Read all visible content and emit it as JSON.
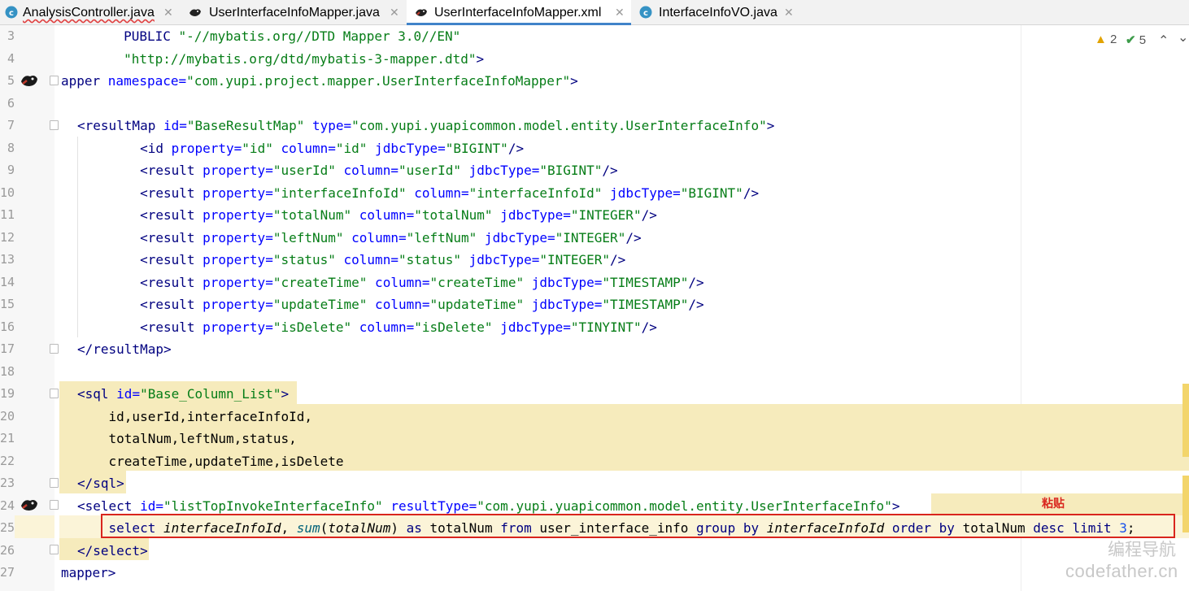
{
  "tabs": [
    {
      "label": "AnalysisController.java",
      "icon": "java-class-icon"
    },
    {
      "label": "UserInterfaceInfoMapper.java",
      "icon": "mybatis-icon"
    },
    {
      "label": "UserInterfaceInfoMapper.xml",
      "icon": "mybatis-icon",
      "active": true
    },
    {
      "label": "InterfaceInfoVO.java",
      "icon": "java-class-icon"
    }
  ],
  "tab_close": "✕",
  "status": {
    "warnings": "2",
    "checks": "5",
    "up": "⌃",
    "down": "⌄"
  },
  "lines": [
    {
      "n": "3",
      "t": [
        "        PUBLIC ",
        "\"-//mybatis.org//DTD Mapper 3.0//EN\""
      ]
    },
    {
      "n": "4",
      "t": [
        "        ",
        "\"http://mybatis.org/dtd/mybatis-3-mapper.dtd\"",
        ">"
      ]
    },
    {
      "n": "5",
      "t": [
        "apper ",
        "namespace=",
        "\"com.yupi.project.mapper.UserInterfaceInfoMapper\"",
        ">"
      ]
    },
    {
      "n": "6",
      "t": [
        ""
      ]
    },
    {
      "n": "7",
      "t": [
        "<resultMap ",
        "id=",
        "\"BaseResultMap\"",
        " type=",
        "\"com.yupi.yuapicommon.model.entity.UserInterfaceInfo\"",
        ">"
      ]
    },
    {
      "n": "8",
      "t": [
        "        <id ",
        "property=",
        "\"id\"",
        " column=",
        "\"id\"",
        " jdbcType=",
        "\"BIGINT\"",
        "/>"
      ]
    },
    {
      "n": "9",
      "t": [
        "        <result ",
        "property=",
        "\"userId\"",
        " column=",
        "\"userId\"",
        " jdbcType=",
        "\"BIGINT\"",
        "/>"
      ]
    },
    {
      "n": "10",
      "t": [
        "        <result ",
        "property=",
        "\"interfaceInfoId\"",
        " column=",
        "\"interfaceInfoId\"",
        " jdbcType=",
        "\"BIGINT\"",
        "/>"
      ]
    },
    {
      "n": "11",
      "t": [
        "        <result ",
        "property=",
        "\"totalNum\"",
        " column=",
        "\"totalNum\"",
        " jdbcType=",
        "\"INTEGER\"",
        "/>"
      ]
    },
    {
      "n": "12",
      "t": [
        "        <result ",
        "property=",
        "\"leftNum\"",
        " column=",
        "\"leftNum\"",
        " jdbcType=",
        "\"INTEGER\"",
        "/>"
      ]
    },
    {
      "n": "13",
      "t": [
        "        <result ",
        "property=",
        "\"status\"",
        " column=",
        "\"status\"",
        " jdbcType=",
        "\"INTEGER\"",
        "/>"
      ]
    },
    {
      "n": "14",
      "t": [
        "        <result ",
        "property=",
        "\"createTime\"",
        " column=",
        "\"createTime\"",
        " jdbcType=",
        "\"TIMESTAMP\"",
        "/>"
      ]
    },
    {
      "n": "15",
      "t": [
        "        <result ",
        "property=",
        "\"updateTime\"",
        " column=",
        "\"updateTime\"",
        " jdbcType=",
        "\"TIMESTAMP\"",
        "/>"
      ]
    },
    {
      "n": "16",
      "t": [
        "        <result ",
        "property=",
        "\"isDelete\"",
        " column=",
        "\"isDelete\"",
        " jdbcType=",
        "\"TINYINT\"",
        "/>"
      ]
    },
    {
      "n": "17",
      "t": [
        "</resultMap>"
      ]
    },
    {
      "n": "18",
      "t": [
        ""
      ]
    },
    {
      "n": "19",
      "t": [
        "<sql ",
        "id=",
        "\"Base_Column_List\"",
        ">"
      ]
    },
    {
      "n": "20",
      "t": [
        "    id,userId,interfaceInfoId,"
      ]
    },
    {
      "n": "21",
      "t": [
        "    totalNum,leftNum,status,"
      ]
    },
    {
      "n": "22",
      "t": [
        "    createTime,updateTime,isDelete"
      ]
    },
    {
      "n": "23",
      "t": [
        "</sql>"
      ]
    },
    {
      "n": "24",
      "t": [
        "<select ",
        "id=",
        "\"listTopInvokeInterfaceInfo\"",
        " resultType=",
        "\"com.yupi.yuapicommon.model.entity.UserInterfaceInfo\"",
        ">"
      ]
    },
    {
      "n": "25",
      "t": [
        "    select ",
        "interfaceInfoId",
        ", ",
        "sum",
        "(",
        "totalNum",
        ") ",
        "as",
        " totalNum ",
        "from",
        " user_interface_info ",
        "group by",
        " ",
        "interfaceInfoId",
        " ",
        "order by",
        " totalNum ",
        "desc",
        " ",
        "limit",
        " ",
        "3",
        ";"
      ]
    },
    {
      "n": "26",
      "t": [
        "</select>"
      ]
    },
    {
      "n": "27",
      "t": [
        "mapper>"
      ]
    }
  ],
  "annotation": "粘贴",
  "watermark": {
    "cn": "编程导航",
    "en": "codefather.cn"
  }
}
